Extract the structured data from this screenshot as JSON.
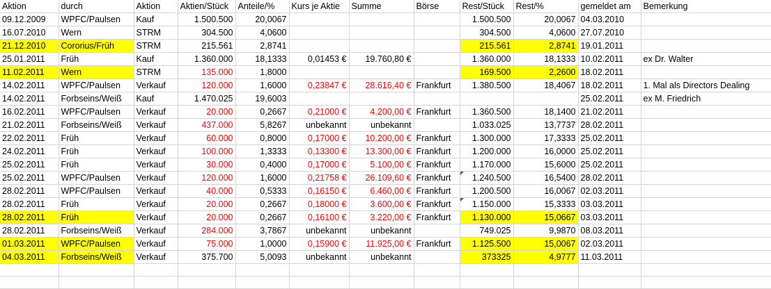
{
  "columns": [
    "Aktion",
    "durch",
    "Aktion",
    "Aktien/Stück",
    "Anteile/%",
    "Kurs je Aktie",
    "Summe",
    "Börse",
    "Rest/Stück",
    "Rest/%",
    "gemeldet am",
    "Bemerkung"
  ],
  "rows": [
    {
      "c": [
        "09.12.2009",
        "WPFC/Paulsen",
        "Kauf",
        "1.500.500",
        "20,0067",
        "",
        "",
        "",
        "1.500.500",
        "20,0067",
        "04.03.2010",
        ""
      ]
    },
    {
      "c": [
        "16.07.2010",
        "Wern",
        "STRM",
        "304.500",
        "4,0600",
        "",
        "",
        "",
        "304.500",
        "4,0600",
        "27.07.2010",
        ""
      ]
    },
    {
      "c": [
        "21.12.2010",
        "Cororius/Früh",
        "STRM",
        "215.561",
        "2,8741",
        "",
        "",
        "",
        "215.561",
        "2,8741",
        "19.01.2011",
        ""
      ],
      "hl": [
        0,
        1,
        8,
        9
      ]
    },
    {
      "c": [
        "25.01.2011",
        "Früh",
        "Kauf",
        "1.360.000",
        "18,1333",
        "0,01453 €",
        "19.760,80 €",
        "",
        "1.360.000",
        "18,1333",
        "10.02.2011",
        "ex Dr. Walter"
      ]
    },
    {
      "c": [
        "11.02.2011",
        "Wern",
        "STRM",
        "135.000",
        "1,8000",
        "",
        "",
        "",
        "169.500",
        "2,2600",
        "18.02.2011",
        ""
      ],
      "hl": [
        0,
        1,
        8,
        9
      ],
      "red": [
        3
      ]
    },
    {
      "c": [
        "14.02.2011",
        "WPFC/Paulsen",
        "Verkauf",
        "120.000",
        "1,6000",
        "0,23847 €",
        "28.616,40 €",
        "Frankfurt",
        "1.380.500",
        "18,4067",
        "18.02.2011",
        "1. Mal als Directors Dealing"
      ],
      "red": [
        3,
        5,
        6
      ]
    },
    {
      "c": [
        "14.02.2011",
        "Forbseins/Weiß",
        "Kauf",
        "1.470.025",
        "19,6003",
        "",
        "",
        "",
        "",
        "",
        "25.02.2011",
        "ex M. Friedrich"
      ]
    },
    {
      "c": [
        "16.02.2011",
        "WPFC/Paulsen",
        "Verkauf",
        "20.000",
        "0,2667",
        "0,21000 €",
        "4.200,00 €",
        "Frankfurt",
        "1.360.500",
        "18,1400",
        "21.02.2011",
        ""
      ],
      "red": [
        3,
        5,
        6
      ]
    },
    {
      "c": [
        "21.02.2011",
        "Forbseins/Weiß",
        "Verkauf",
        "437.000",
        "5,8267",
        "unbekannt",
        "unbekannt",
        "",
        "1.033.025",
        "13,7737",
        "28.02.2011",
        ""
      ],
      "red": [
        3
      ]
    },
    {
      "c": [
        "22.02.2011",
        "Früh",
        "Verkauf",
        "60.000",
        "0,8000",
        "0,17000 €",
        "10.200,00 €",
        "Frankfurt",
        "1.300.000",
        "17,3333",
        "25.02.2011",
        ""
      ],
      "red": [
        3,
        5,
        6
      ]
    },
    {
      "c": [
        "24.02.2011",
        "Früh",
        "Verkauf",
        "100.000",
        "1,3333",
        "0,13300 €",
        "13.300,00 €",
        "Frankfurt",
        "1.200.000",
        "16,0000",
        "25.02.2011",
        ""
      ],
      "red": [
        3,
        5,
        6
      ]
    },
    {
      "c": [
        "25.02.2011",
        "Früh",
        "Verkauf",
        "30.000",
        "0,4000",
        "0,17000 €",
        "5.100,00 €",
        "Frankfurt",
        "1.170.000",
        "15,6000",
        "25.02.2011",
        ""
      ],
      "red": [
        3,
        5,
        6
      ]
    },
    {
      "c": [
        "25.02.2011",
        "WPFC/Paulsen",
        "Verkauf",
        "120.000",
        "1,6000",
        "0,21758 €",
        "26.109,60 €",
        "Frankfurt",
        "1.240.500",
        "16,5400",
        "28.02.2011",
        ""
      ],
      "red": [
        3,
        5,
        6
      ],
      "mark": [
        8
      ]
    },
    {
      "c": [
        "28.02.2011",
        "WPFC/Paulsen",
        "Verkauf",
        "40.000",
        "0,5333",
        "0,16150 €",
        "6.460,00 €",
        "Frankfurt",
        "1.200.500",
        "16,0067",
        "02.03.2011",
        ""
      ],
      "red": [
        3,
        5,
        6
      ]
    },
    {
      "c": [
        "28.02.2011",
        "Früh",
        "Verkauf",
        "20.000",
        "0,2667",
        "0,18000 €",
        "3.600,00 €",
        "Frankfurt",
        "1.150.000",
        "15,3333",
        "03.03.2011",
        ""
      ],
      "red": [
        3,
        5,
        6
      ],
      "mark": [
        8
      ]
    },
    {
      "c": [
        "28.02.2011",
        "Früh",
        "Verkauf",
        "20.000",
        "0,2667",
        "0,16100 €",
        "3.220,00 €",
        "Frankfurt",
        "1.130.000",
        "15,0667",
        "03.03.2011",
        ""
      ],
      "hl": [
        0,
        1,
        8,
        9
      ],
      "red": [
        3,
        5,
        6
      ]
    },
    {
      "c": [
        "28.02.2011",
        "Forbseins/Weiß",
        "Verkauf",
        "284.000",
        "3,7867",
        "unbekannt",
        "unbekannt",
        "",
        "749.025",
        "9,9870",
        "08.03.2011",
        ""
      ],
      "red": [
        3
      ]
    },
    {
      "c": [
        "01.03.2011",
        "WPFC/Paulsen",
        "Verkauf",
        "75.000",
        "1,0000",
        "0,15900 €",
        "11.925,00 €",
        "Frankfurt",
        "1.125.500",
        "15,0067",
        "02.03.2011",
        ""
      ],
      "hl": [
        0,
        1,
        8,
        9
      ],
      "red": [
        3,
        5,
        6
      ]
    },
    {
      "c": [
        "04.03.2011",
        "Forbseins/Weiß",
        "Verkauf",
        "375.700",
        "5,0093",
        "unbekannt",
        "unbekannt",
        "",
        "373325",
        "4,9777",
        "11.03.2011",
        ""
      ],
      "hl": [
        0,
        1,
        8,
        9
      ]
    },
    {
      "c": [
        "",
        "",
        "",
        "",
        "",
        "",
        "",
        "",
        "",
        "",
        "",
        ""
      ]
    },
    {
      "c": [
        "",
        "",
        "",
        "",
        "",
        "",
        "",
        "",
        "",
        "",
        "",
        ""
      ]
    }
  ]
}
